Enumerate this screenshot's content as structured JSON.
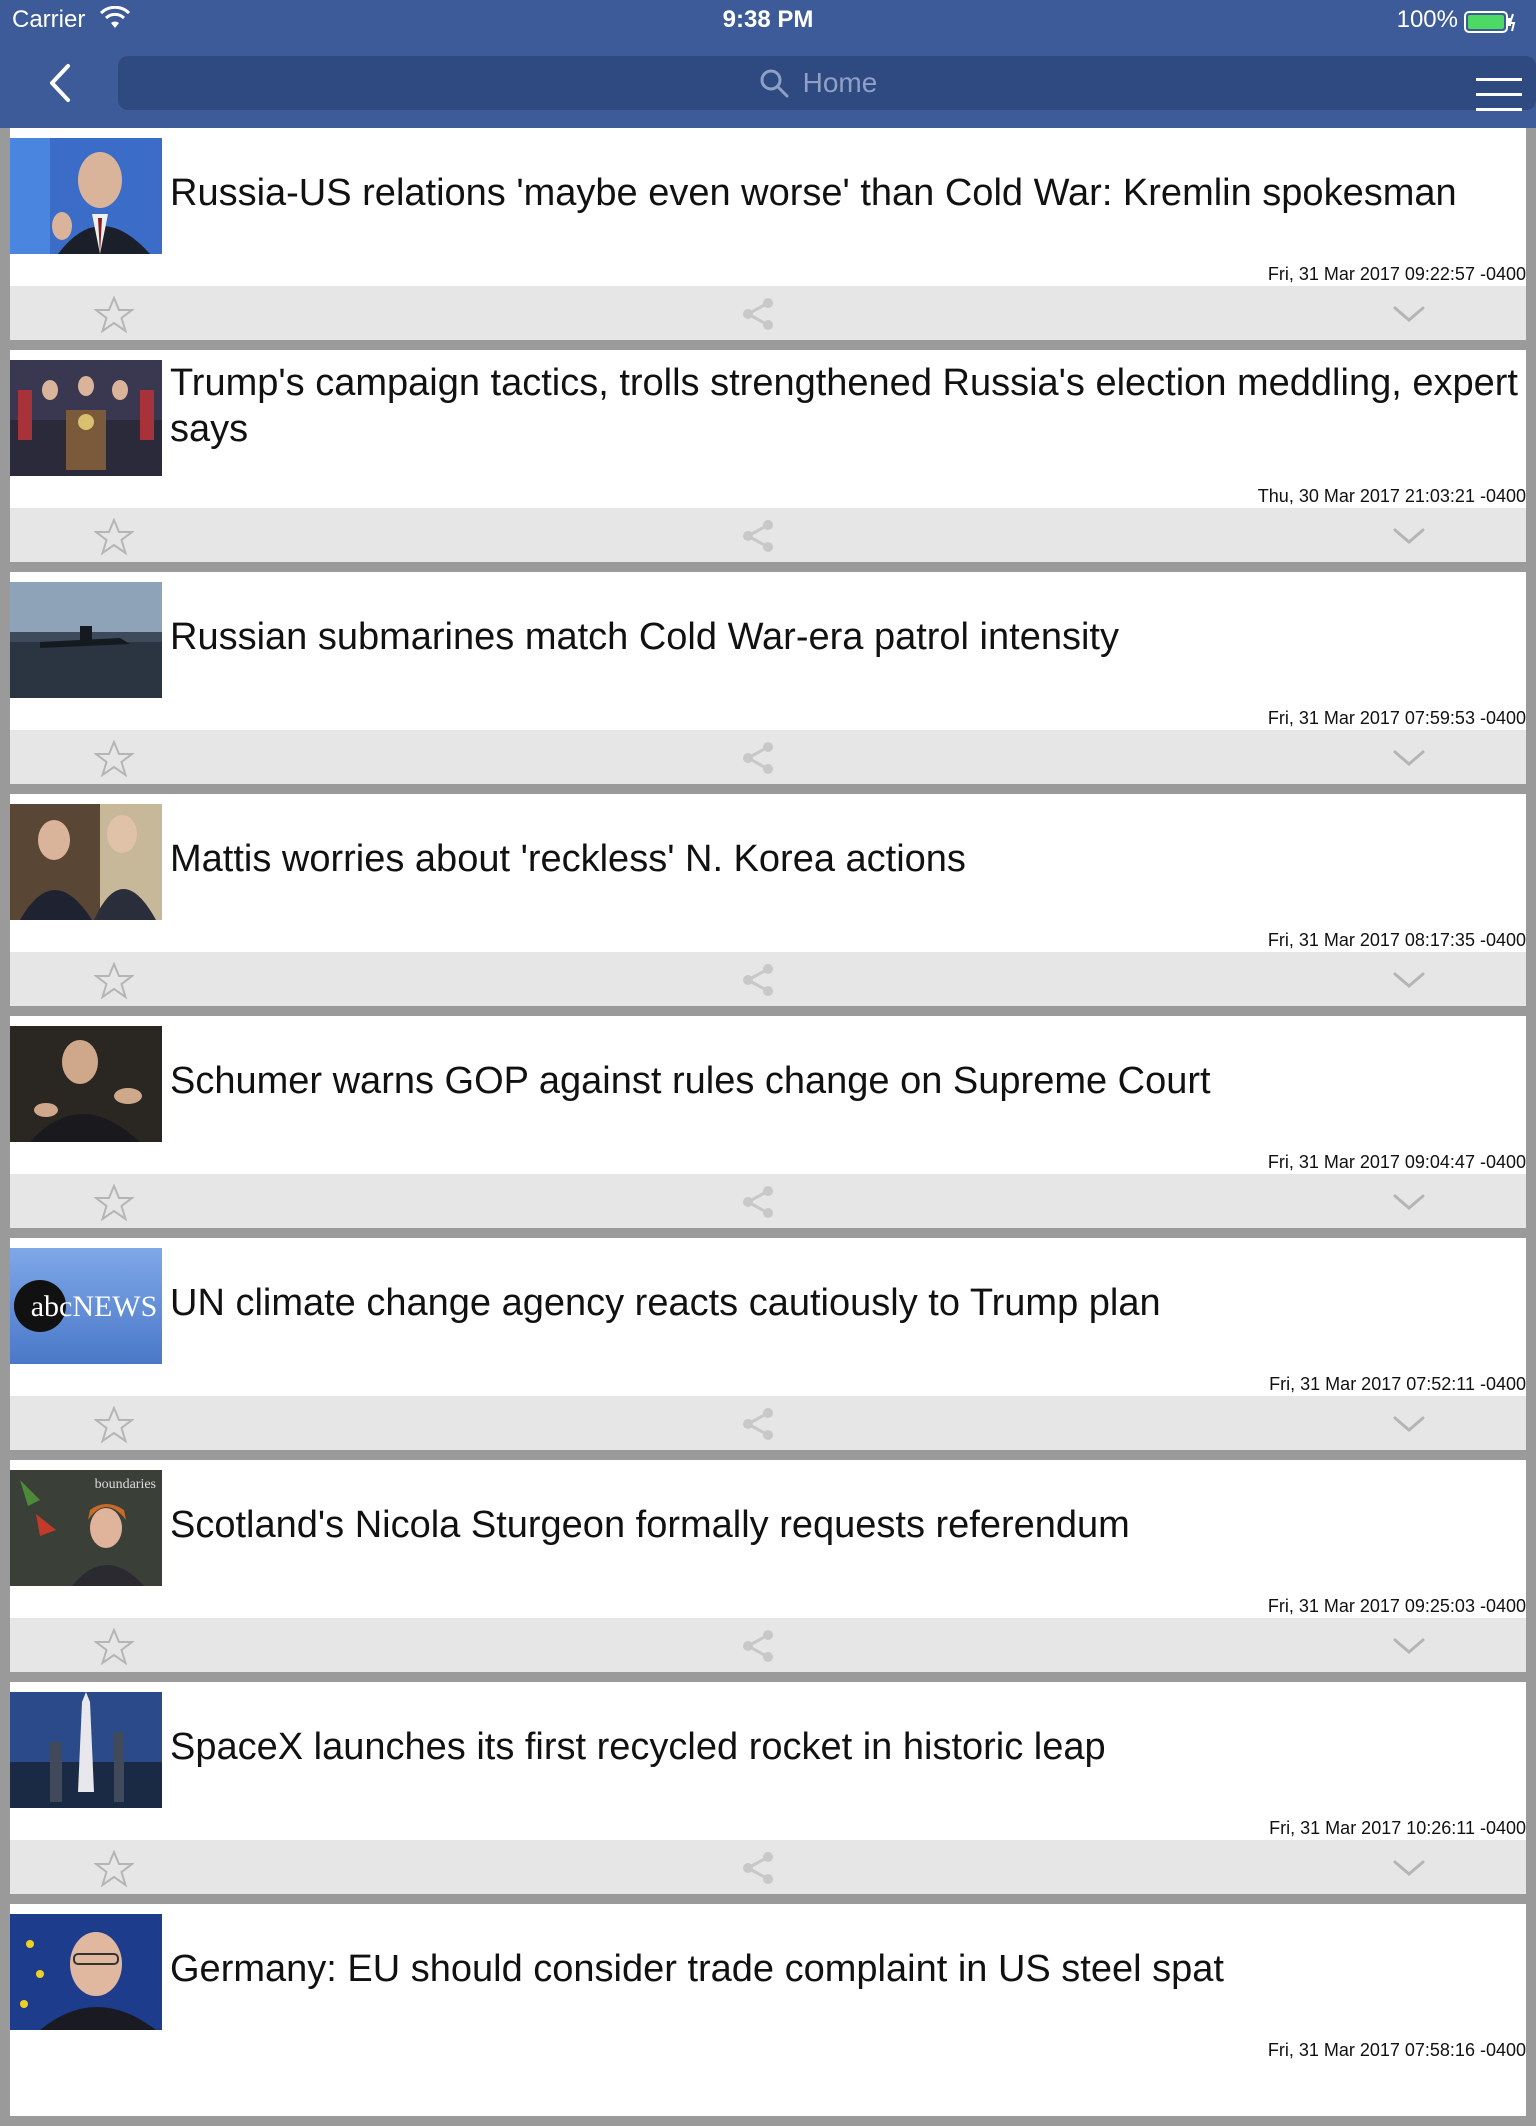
{
  "status_bar": {
    "carrier": "Carrier",
    "time": "9:38 PM",
    "battery": "100%"
  },
  "nav": {
    "search_text": "Home"
  },
  "articles": [
    {
      "headline": "Russia-US relations 'maybe even worse' than Cold War: Kremlin spokesman",
      "date": "Fri, 31 Mar 2017 09:22:57 -0400"
    },
    {
      "headline": "Trump's campaign tactics, trolls strengthened Russia's election meddling, expert says",
      "date": "Thu, 30 Mar 2017 21:03:21 -0400"
    },
    {
      "headline": "Russian submarines match Cold War-era patrol intensity",
      "date": "Fri, 31 Mar 2017 07:59:53 -0400"
    },
    {
      "headline": "Mattis worries about 'reckless' N. Korea actions",
      "date": "Fri, 31 Mar 2017 08:17:35 -0400"
    },
    {
      "headline": "Schumer warns GOP against rules change on Supreme Court",
      "date": "Fri, 31 Mar 2017 09:04:47 -0400"
    },
    {
      "headline": "UN climate change agency reacts cautiously to Trump plan",
      "date": "Fri, 31 Mar 2017 07:52:11 -0400",
      "thumb_text": "abcNEWS"
    },
    {
      "headline": "Scotland's Nicola Sturgeon formally requests referendum",
      "date": "Fri, 31 Mar 2017 09:25:03 -0400",
      "thumb_text": "boundaries"
    },
    {
      "headline": "SpaceX launches its first recycled rocket in historic leap",
      "date": "Fri, 31 Mar 2017 10:26:11 -0400"
    },
    {
      "headline": "Germany: EU should consider trade complaint in US steel spat",
      "date": "Fri, 31 Mar 2017 07:58:16 -0400"
    }
  ],
  "colors": {
    "nav_background": "#3d5a99",
    "search_background": "#2f4a80",
    "action_bar": "#e6e6e6",
    "battery_green": "#4cd964"
  },
  "icons": [
    "wifi-icon",
    "battery-icon",
    "back-icon",
    "search-icon",
    "menu-icon",
    "star-icon",
    "share-icon",
    "chevron-down-icon"
  ]
}
